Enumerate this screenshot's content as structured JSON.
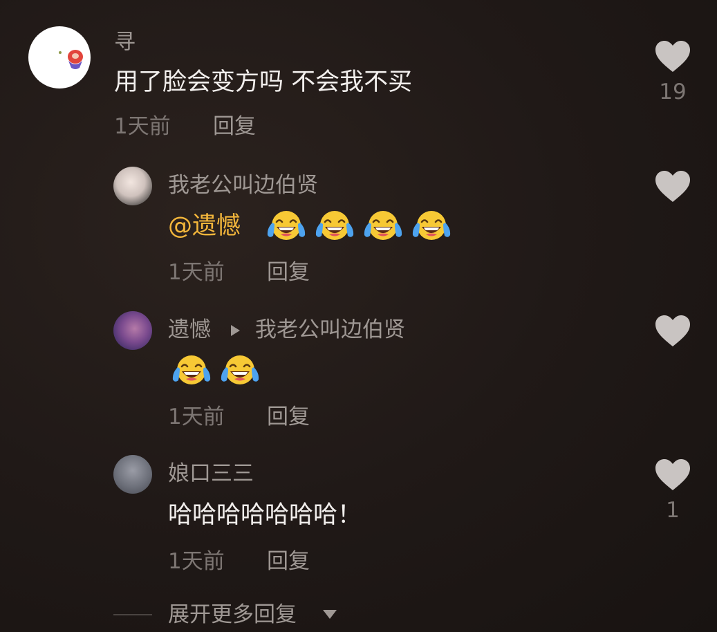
{
  "comments": [
    {
      "username": "寻",
      "text": "用了脸会变方吗 不会我不买",
      "time": "1天前",
      "reply_label": "回复",
      "likes": "19"
    }
  ],
  "replies": [
    {
      "username": "我老公叫边伯贤",
      "mention": "@遗憾",
      "emoji_count": 4,
      "time": "1天前",
      "reply_label": "回复"
    },
    {
      "username": "遗憾",
      "reply_to": "我老公叫边伯贤",
      "emoji_count": 2,
      "time": "1天前",
      "reply_label": "回复"
    },
    {
      "username": "娘口三三",
      "text": "哈哈哈哈哈哈哈！",
      "time": "1天前",
      "reply_label": "回复",
      "likes": "1"
    }
  ],
  "expand_more_label": "展开更多回复",
  "emoji_name": "tears-of-joy-emoji",
  "colors": {
    "background": "#1e1816",
    "comment_text": "#f2efed",
    "username_text": "#9f9894",
    "meta_text": "#7d7673",
    "mention": "#f3b63b",
    "heart": "#c9c4c2"
  }
}
